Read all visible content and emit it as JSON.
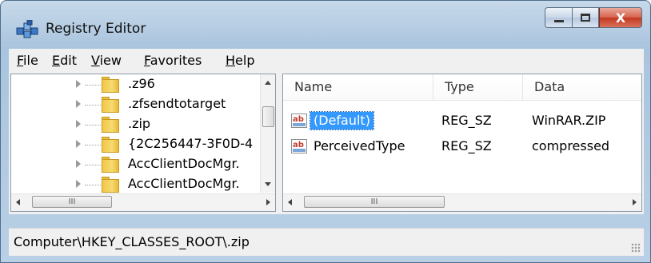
{
  "window": {
    "title": "Registry Editor"
  },
  "caption_buttons": {
    "minimize": "minimize",
    "maximize": "maximize",
    "close": "X"
  },
  "menu": [
    {
      "label": "File",
      "accel": "F",
      "rest": "ile"
    },
    {
      "label": "Edit",
      "accel": "E",
      "rest": "dit"
    },
    {
      "label": "View",
      "accel": "V",
      "rest": "iew"
    },
    {
      "label": "Favorites",
      "accel": "F",
      "rest": "avorites"
    },
    {
      "label": "Help",
      "accel": "H",
      "rest": "elp"
    }
  ],
  "tree": {
    "items": [
      {
        "label": ".z96"
      },
      {
        "label": ".zfsendtotarget"
      },
      {
        "label": ".zip"
      },
      {
        "label": "{2C256447-3F0D-4"
      },
      {
        "label": "AccClientDocMgr."
      },
      {
        "label": "AccClientDocMgr."
      }
    ],
    "hscroll_grip": "III"
  },
  "values": {
    "columns": {
      "name": "Name",
      "type": "Type",
      "data": "Data"
    },
    "rows": [
      {
        "icon": "ab",
        "name": "(Default)",
        "type": "REG_SZ",
        "data": "WinRAR.ZIP",
        "selected": true
      },
      {
        "icon": "ab",
        "name": "PerceivedType",
        "type": "REG_SZ",
        "data": "compressed",
        "selected": false
      }
    ],
    "hscroll_grip": "III"
  },
  "status": {
    "path": "Computer\\HKEY_CLASSES_ROOT\\.zip"
  },
  "colors": {
    "selection": "#3399ff",
    "folder": "#f1c84a",
    "close_button": "#c1381f"
  }
}
